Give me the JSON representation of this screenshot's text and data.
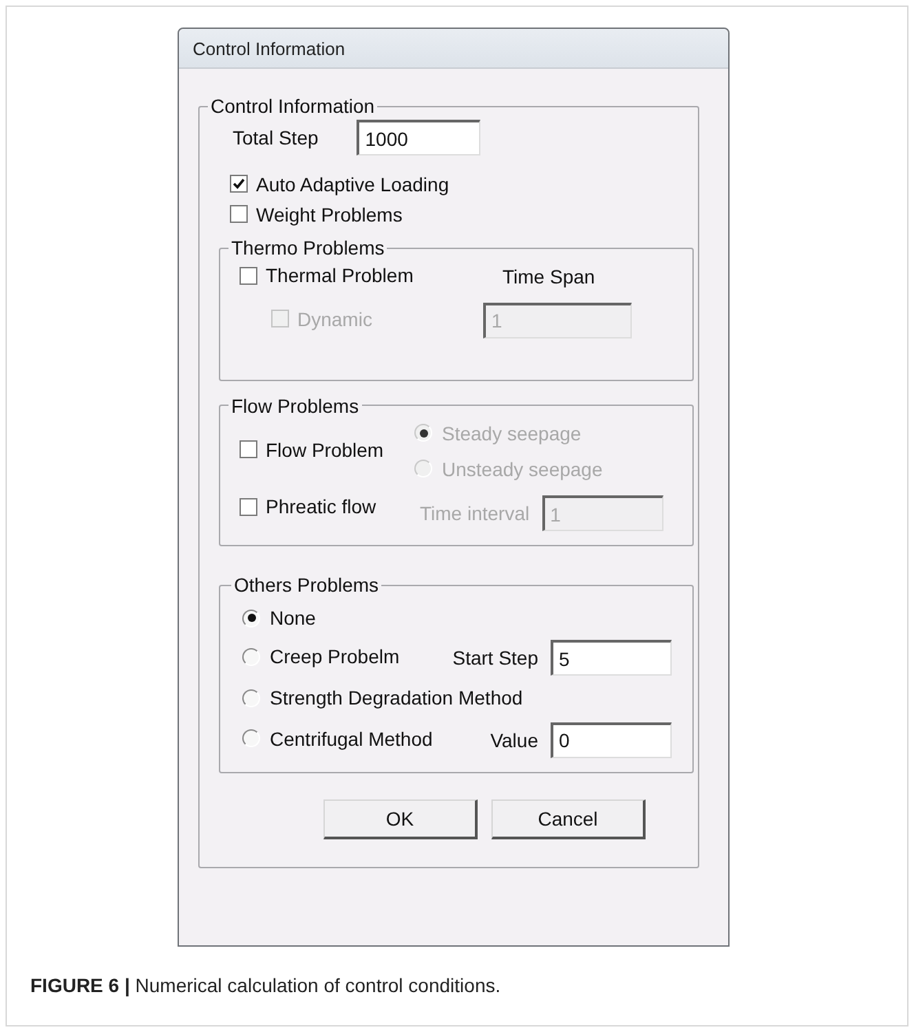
{
  "window": {
    "title": "Control Information"
  },
  "control_group": {
    "title": "Control Information",
    "total_step": {
      "label": "Total Step",
      "value": "1000"
    },
    "options": [
      {
        "label": "Auto Adaptive Loading",
        "checked": true
      },
      {
        "label": "Weight Problems",
        "checked": false
      }
    ],
    "thermo": {
      "title": "Thermo Problems",
      "thermal": {
        "label": "Thermal Problem",
        "checked": false
      },
      "time_span_label": "Time Span",
      "dynamic": {
        "label": "Dynamic",
        "checked": false,
        "disabled": true
      },
      "time_span": {
        "value": "1",
        "disabled": true
      }
    },
    "flow": {
      "title": "Flow Problems",
      "checks": [
        {
          "label": "Flow Problem",
          "checked": false
        },
        {
          "label": "Phreatic flow",
          "checked": false
        }
      ],
      "seepage": [
        {
          "label": "Steady seepage",
          "selected": true,
          "disabled": true
        },
        {
          "label": "Unsteady seepage",
          "selected": false,
          "disabled": true
        }
      ],
      "time_interval": {
        "label": "Time interval",
        "value": "1",
        "disabled": true
      }
    },
    "others": {
      "title": "Others Problems",
      "choices": [
        {
          "label": "None",
          "selected": true
        },
        {
          "label": "Creep Probelm",
          "selected": false,
          "field_label": "Start Step",
          "value": "5"
        },
        {
          "label": "Strength Degradation Method",
          "selected": false
        },
        {
          "label": "Centrifugal Method",
          "selected": false,
          "field_label": "Value",
          "value": "0"
        }
      ]
    }
  },
  "buttons": [
    "OK",
    "Cancel"
  ],
  "caption": "**FIGURE 6 |** Numerical calculation of control conditions."
}
